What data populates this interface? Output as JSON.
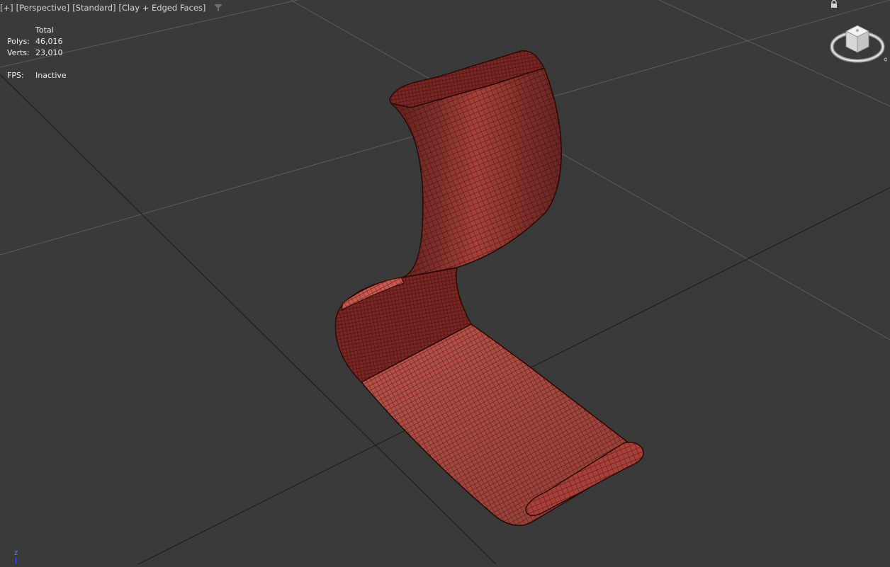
{
  "viewport": {
    "labels": [
      "[+]",
      "[Perspective]",
      "[Standard]",
      "[Clay + Edged Faces]"
    ],
    "background": "#3a3a3a",
    "model_color": "#a8403a"
  },
  "stats": {
    "header": "Total",
    "polys_label": "Polys:",
    "polys_value": "46,016",
    "verts_label": "Verts:",
    "verts_value": "23,010",
    "fps_label": "FPS:",
    "fps_value": "Inactive"
  },
  "axis": {
    "z_label": "z"
  },
  "icons": {
    "filter": "filter-icon",
    "viewcube": "viewcube-icon",
    "lock": "lock-icon"
  }
}
